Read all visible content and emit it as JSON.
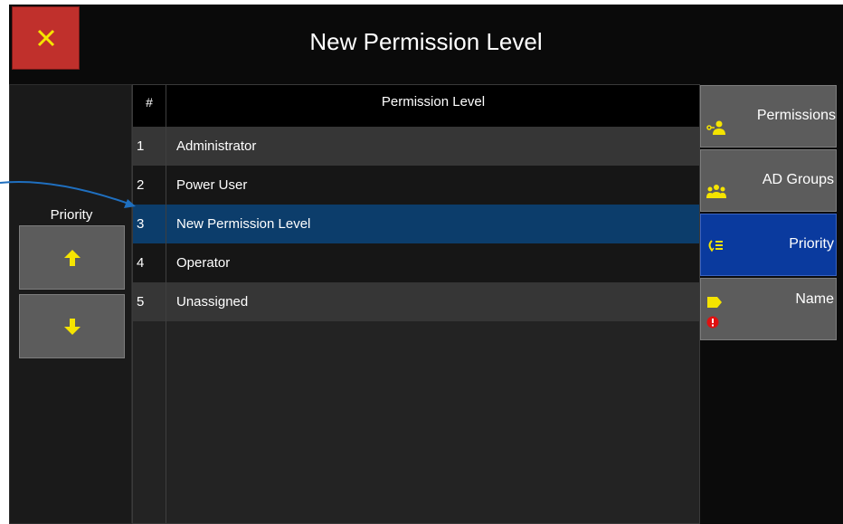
{
  "dialog": {
    "title": "New Permission Level",
    "close_icon": "close-icon"
  },
  "left_panel": {
    "priority_label": "Priority",
    "up_icon": "arrow-up-icon",
    "down_icon": "arrow-down-icon"
  },
  "table": {
    "columns": [
      "#",
      "Permission Level"
    ],
    "rows": [
      {
        "num": "1",
        "name": "Administrator"
      },
      {
        "num": "2",
        "name": "Power User"
      },
      {
        "num": "3",
        "name": "New Permission Level",
        "selected": true
      },
      {
        "num": "4",
        "name": "Operator"
      },
      {
        "num": "5",
        "name": "Unassigned"
      }
    ]
  },
  "nav": {
    "items": [
      {
        "label": "Permissions",
        "icon": "user-key-icon"
      },
      {
        "label": "AD Groups",
        "icon": "user-group-icon"
      },
      {
        "label": "Priority",
        "icon": "priority-list-icon",
        "active": true
      },
      {
        "label": "Name",
        "icon": "tag-icon"
      }
    ],
    "name_alert_icon": "error-icon"
  },
  "colors": {
    "close": "#c0302c",
    "selected_row": "#0c3d6b",
    "active_nav": "#0a3a9e",
    "icon_yellow": "#f5e400",
    "error_red": "#e01010",
    "annotation_arrow": "#1f6fbf"
  }
}
